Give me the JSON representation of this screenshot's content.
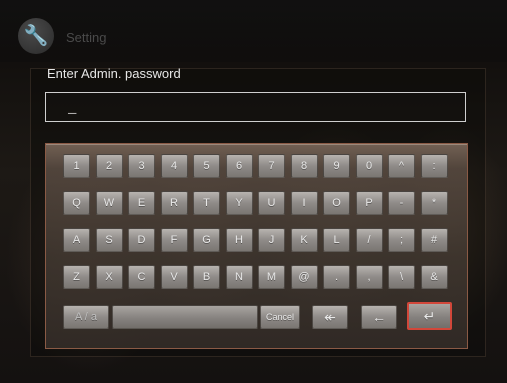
{
  "header": {
    "title": "Setting",
    "icon": "wrench-icon"
  },
  "dialog": {
    "prompt": "Enter Admin. password",
    "field_value": "_"
  },
  "keyboard": {
    "rows": [
      [
        "1",
        "2",
        "3",
        "4",
        "5",
        "6",
        "7",
        "8",
        "9",
        "0",
        "^",
        ":"
      ],
      [
        "Q",
        "W",
        "E",
        "R",
        "T",
        "Y",
        "U",
        "I",
        "O",
        "P",
        "-",
        "*"
      ],
      [
        "A",
        "S",
        "D",
        "F",
        "G",
        "H",
        "J",
        "K",
        "L",
        "/",
        ";",
        "#"
      ],
      [
        "Z",
        "X",
        "C",
        "V",
        "B",
        "N",
        "M",
        "@",
        ".",
        ",",
        "\\",
        "&"
      ]
    ],
    "toggle_case": "A / a",
    "space": "",
    "cancel": "Cancel",
    "backspace": "↞",
    "left": "←",
    "enter": "↵"
  },
  "colors": {
    "enter_border": "#d2473a",
    "keyboard_border": "#8a5a45"
  }
}
